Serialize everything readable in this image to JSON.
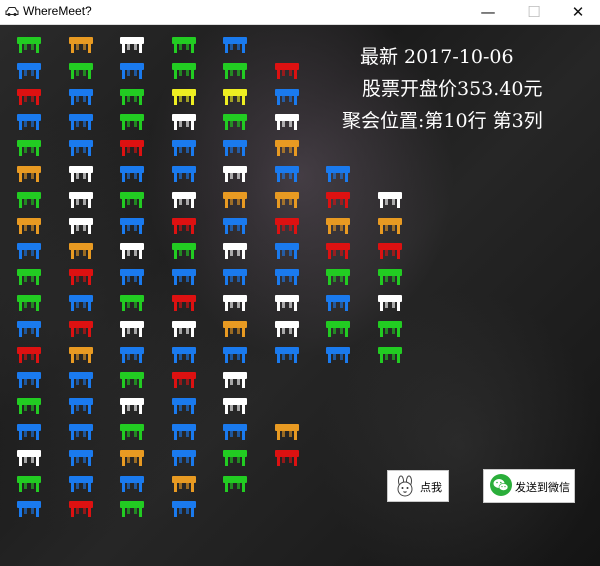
{
  "window": {
    "title": "WhereMeet?",
    "controls": {
      "minimize": "—",
      "maximize": "☐",
      "close": "✕"
    }
  },
  "info": {
    "latest": "最新 2017-10-06",
    "open_price": "股票开盘价353.40元",
    "meeting_location": "聚会位置:第10行 第3列"
  },
  "buttons": {
    "click_me": "点我",
    "send_to_wechat": "发送到微信"
  },
  "icons": {
    "app": "sedan-car-icon",
    "click_me": "bunny-face-icon",
    "send_to_wechat": "wechat-icon"
  },
  "colors": {
    "g": "#22cc22",
    "o": "#e89a22",
    "w": "#ffffff",
    "b": "#1a7aee",
    "r": "#dd1111",
    "y": "#eeee22"
  },
  "table_grid": {
    "rows": [
      "gowgb",
      "bgbggr",
      "rbgyyb",
      "bbgwgw",
      "gbrbbo",
      "owbbwbb",
      "gwgwoorw",
      "owbrbroo",
      "bowgwbrr",
      "grbbbbgg",
      "gbgrwwbw",
      "brwwowgg",
      "robbbbbg",
      "bbgrw",
      "gbwbw",
      "bbgbbo",
      "wbobgr",
      "gbbog",
      "brgb"
    ]
  }
}
